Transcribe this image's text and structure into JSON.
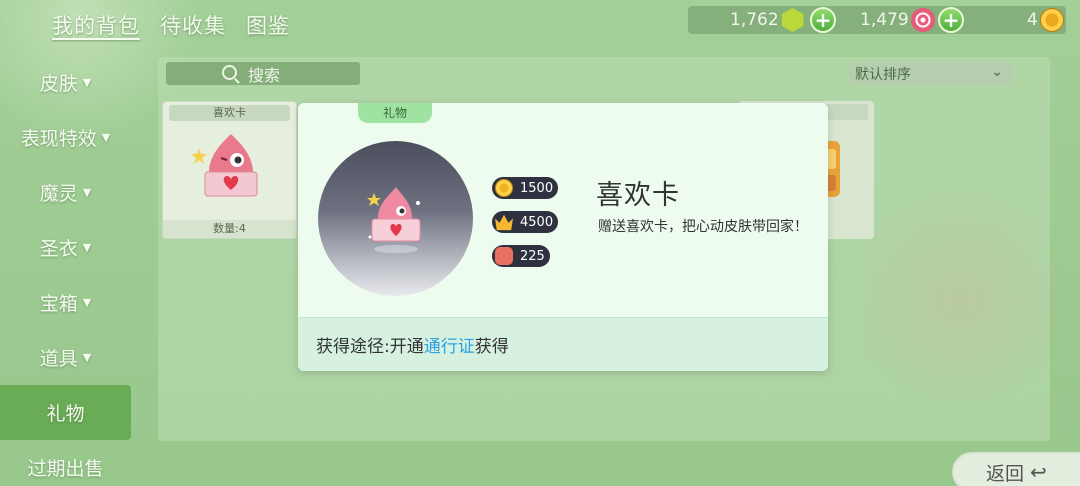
{
  "top_tabs": [
    {
      "label": "我的背包",
      "active": true
    },
    {
      "label": "待收集",
      "active": false
    },
    {
      "label": "图鉴",
      "active": false
    }
  ],
  "currency": {
    "gems": "1,762",
    "candy": "1,479",
    "coins": "4"
  },
  "search": {
    "label": "搜索"
  },
  "sort": {
    "selected": "默认排序"
  },
  "sidebar": {
    "items": [
      {
        "label": "皮肤",
        "arrow": "▼"
      },
      {
        "label": "表现特效",
        "arrow": "▼"
      },
      {
        "label": "魔灵",
        "arrow": "▼"
      },
      {
        "label": "圣衣",
        "arrow": "▼"
      },
      {
        "label": "宝箱",
        "arrow": "▼"
      },
      {
        "label": "道具",
        "arrow": "▼"
      },
      {
        "label": "礼物",
        "arrow": "",
        "active": true
      },
      {
        "label": "过期出售",
        "arrow": ""
      }
    ]
  },
  "card": {
    "name": "喜欢卡",
    "qty": "数量:4"
  },
  "modal": {
    "tab": "礼物",
    "title": "喜欢卡",
    "description": "赠送喜欢卡，把心动皮肤带回家！",
    "stats": {
      "coin": "1500",
      "crown": "4500",
      "badge": "225"
    },
    "footer_prefix": "获得途径:开通",
    "footer_link": "通行证",
    "footer_suffix": "获得"
  },
  "return_button": {
    "label": "返回"
  }
}
